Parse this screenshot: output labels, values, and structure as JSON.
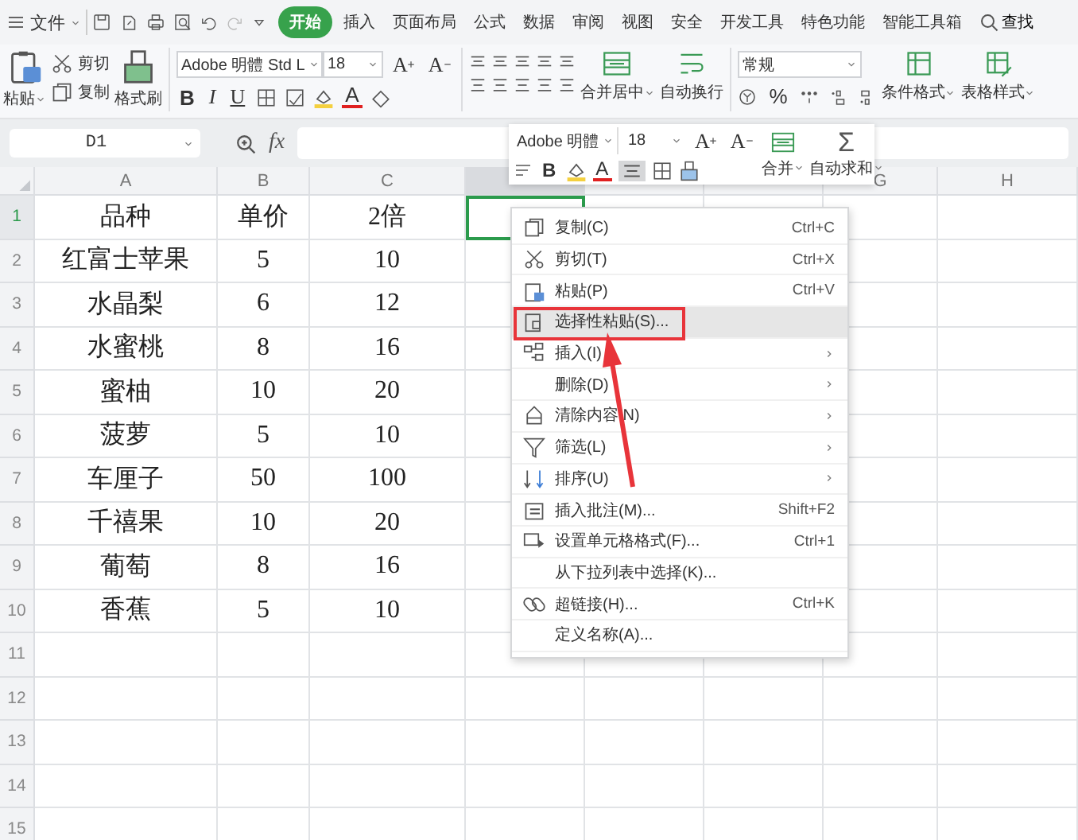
{
  "menu_bar": {
    "file_menu": "文件",
    "tabs": [
      {
        "label": "开始",
        "selected": true
      },
      {
        "label": "插入",
        "selected": false
      },
      {
        "label": "页面布局",
        "selected": false
      },
      {
        "label": "公式",
        "selected": false
      },
      {
        "label": "数据",
        "selected": false
      },
      {
        "label": "审阅",
        "selected": false
      },
      {
        "label": "视图",
        "selected": false
      },
      {
        "label": "安全",
        "selected": false
      },
      {
        "label": "开发工具",
        "selected": false
      },
      {
        "label": "特色功能",
        "selected": false
      },
      {
        "label": "智能工具箱",
        "selected": false
      }
    ],
    "search": "查找"
  },
  "ribbon": {
    "paste": "粘贴",
    "cut": "剪切",
    "copy": "复制",
    "format_painter": "格式刷",
    "font": "Adobe 明體 Std L",
    "font_size": "18",
    "grow_font": "A",
    "shrink_font": "A",
    "bold": "B",
    "italic": "I",
    "underline": "U",
    "font_color": "A",
    "merge": "合并居中",
    "wrap": "自动换行",
    "number_format": "常规",
    "percent": "%",
    "conditional_format": "条件格式",
    "table_style": "表格样式"
  },
  "formula_bar": {
    "cell_ref": "D1",
    "fx": "fx"
  },
  "mini_toolbar": {
    "font": "Adobe 明體",
    "font_size": "18",
    "grow_font": "A",
    "shrink_font": "A",
    "bold": "B",
    "font_color": "A",
    "merge": "合并",
    "autosum_symbol": "Σ",
    "autosum": "自动求和"
  },
  "sheet": {
    "columns": [
      {
        "label": "A",
        "selected": false
      },
      {
        "label": "B",
        "selected": false
      },
      {
        "label": "C",
        "selected": false
      },
      {
        "selected": true
      },
      {
        "selected": false
      },
      {
        "selected": false
      },
      {
        "label": "G",
        "selected": false
      },
      {
        "label": "H",
        "selected": false
      }
    ],
    "rows": [
      {
        "number": "1",
        "selected": true,
        "cells": [
          "品种",
          "单价",
          "2倍"
        ]
      },
      {
        "number": "2",
        "selected": false,
        "cells": [
          "红富士苹果",
          "5",
          "10"
        ]
      },
      {
        "number": "3",
        "selected": false,
        "cells": [
          "水晶梨",
          "6",
          "12"
        ]
      },
      {
        "number": "4",
        "selected": false,
        "cells": [
          "水蜜桃",
          "8",
          "16"
        ]
      },
      {
        "number": "5",
        "selected": false,
        "cells": [
          "蜜柚",
          "10",
          "20"
        ]
      },
      {
        "number": "6",
        "selected": false,
        "cells": [
          "菠萝",
          "5",
          "10"
        ]
      },
      {
        "number": "7",
        "selected": false,
        "cells": [
          "车厘子",
          "50",
          "100"
        ]
      },
      {
        "number": "8",
        "selected": false,
        "cells": [
          "千禧果",
          "10",
          "20"
        ]
      },
      {
        "number": "9",
        "selected": false,
        "cells": [
          "葡萄",
          "8",
          "16"
        ]
      },
      {
        "number": "10",
        "selected": false,
        "cells": [
          "香蕉",
          "5",
          "10"
        ]
      },
      {
        "number": "11",
        "selected": false
      },
      {
        "number": "12",
        "selected": false
      },
      {
        "number": "13",
        "selected": false
      },
      {
        "number": "14",
        "selected": false
      },
      {
        "number": "15",
        "selected": false
      }
    ]
  },
  "context_menu": {
    "items": [
      {
        "label": "复制(C)",
        "shortcut": "Ctrl+C",
        "submenu": false,
        "selected": false
      },
      {
        "label": "剪切(T)",
        "shortcut": "Ctrl+X",
        "submenu": false,
        "selected": false
      },
      {
        "label": "粘贴(P)",
        "shortcut": "Ctrl+V",
        "submenu": false,
        "selected": false
      },
      {
        "label": "选择性粘贴(S)...",
        "submenu": false,
        "selected": true
      },
      {
        "label": "插入(I)",
        "submenu": true,
        "selected": false
      },
      {
        "label": "删除(D)",
        "submenu": true,
        "selected": false
      },
      {
        "label": "清除内容 N)",
        "submenu": true,
        "selected": false
      },
      {
        "label": "筛选(L)",
        "submenu": true,
        "selected": false
      },
      {
        "label": "排序(U)",
        "submenu": true,
        "selected": false
      },
      {
        "label": "插入批注(M)...",
        "shortcut": "Shift+F2",
        "submenu": false,
        "selected": false
      },
      {
        "label": "设置单元格格式(F)...",
        "shortcut": "Ctrl+1",
        "submenu": false,
        "selected": false
      },
      {
        "label": "从下拉列表中选择(K)...",
        "submenu": false,
        "selected": false
      },
      {
        "label": "超链接(H)...",
        "shortcut": "Ctrl+K",
        "submenu": false,
        "selected": false
      },
      {
        "label": "定义名称(A)...",
        "submenu": false,
        "selected": false
      }
    ]
  }
}
